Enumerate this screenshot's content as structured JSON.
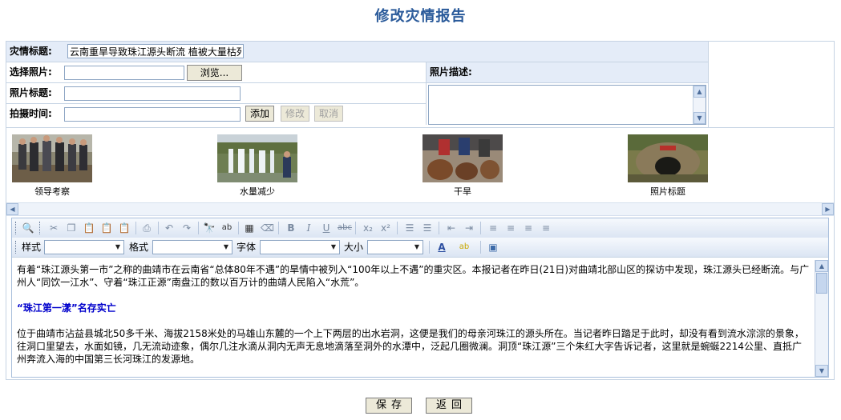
{
  "page": {
    "title": "修改灾情报告"
  },
  "form": {
    "title_label": "灾情标题:",
    "title_value": "云南重旱导致珠江源头断流 植被大量枯死",
    "photo_label": "选择照片:",
    "browse_label": "浏览...",
    "photo_title_label": "照片标题:",
    "date_label": "拍摄时间:",
    "desc_label": "照片描述:",
    "add_label": "添加",
    "edit_label": "修改",
    "cancel_label": "取消"
  },
  "thumbnails": [
    {
      "caption": "领导考察"
    },
    {
      "caption": "水量减少"
    },
    {
      "caption": "干旱"
    },
    {
      "caption": "照片标题"
    }
  ],
  "editor": {
    "style_label": "样式",
    "format_label": "格式",
    "font_label": "字体",
    "size_label": "大小",
    "paragraph1": "有着“珠江源头第一市”之称的曲靖市在云南省“总体80年不遇”的旱情中被列入“100年以上不遇”的重灾区。本报记者在昨日(21日)对曲靖北部山区的探访中发现，珠江源头已经断流。与广州人“同饮一江水”、守着“珠江正源”南盘江的数以百万计的曲靖人民陷入“水荒”。",
    "heading": "“珠江第一漾”名存实亡",
    "paragraph2": "位于曲靖市沾益县城北50多千米、海拔2158米处的马雄山东麓的一个上下两层的出水岩洞，这便是我们的母亲河珠江的源头所在。当记者昨日踏足于此时，却没有看到流水淙淙的景象，往洞口里望去，水面如镜，几无流动迹象，偶尔几注水滴从洞内无声无息地滴落至洞外的水潭中，泛起几圈微澜。洞顶“珠江源”三个朱红大字告诉记者，这里就是蜿蜒2214公里、直抵广州奔流入海的中国第三长河珠江的发源地。"
  },
  "actions": {
    "save_label": "保存",
    "back_label": "返回"
  }
}
